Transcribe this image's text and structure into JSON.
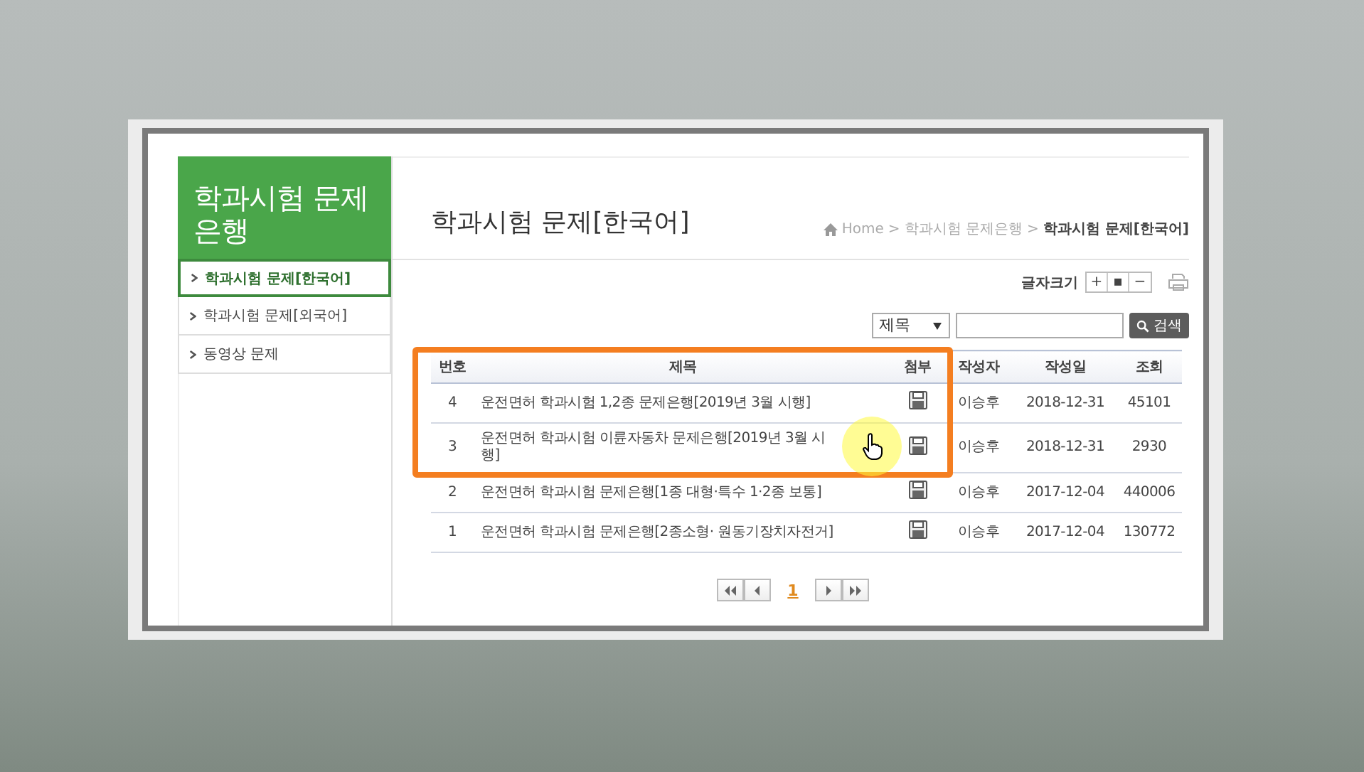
{
  "sidebar": {
    "title": "학과시험 문제은행",
    "items": [
      {
        "label": "학과시험 문제[한국어]",
        "selected": true
      },
      {
        "label": "학과시험 문제[외국어]",
        "selected": false
      },
      {
        "label": "동영상 문제",
        "selected": false
      }
    ]
  },
  "page": {
    "title": "학과시험 문제[한국어]",
    "breadcrumb": [
      "Home",
      "학과시험 문제은행",
      "학과시험 문제[한국어]"
    ],
    "separator": ">"
  },
  "font_size": {
    "label": "글자크기",
    "buttons": [
      "+",
      "▪",
      "−"
    ]
  },
  "search": {
    "option": "제목",
    "button": "검색"
  },
  "table": {
    "columns": [
      "번호",
      "제목",
      "첨부",
      "작성자",
      "작성일",
      "조회"
    ],
    "rows": [
      {
        "no": "4",
        "title": "운전면허 학과시험 1,2종 문제은행[2019년 3월 시행]",
        "attachment": true,
        "author": "이승후",
        "date": "2018-12-31",
        "views": "45101"
      },
      {
        "no": "3",
        "title": "운전면허 학과시험 이륜자동차 문제은행[2019년 3월 시행]",
        "attachment": true,
        "author": "이승후",
        "date": "2018-12-31",
        "views": "2930"
      },
      {
        "no": "2",
        "title": "운전면허 학과시험 문제은행[1종 대형·특수 1·2종 보통]",
        "attachment": true,
        "author": "이승후",
        "date": "2017-12-04",
        "views": "440006"
      },
      {
        "no": "1",
        "title": "운전면허 학과시험 문제은행[2종소형· 원동기장치자전거]",
        "attachment": true,
        "author": "이승후",
        "date": "2017-12-04",
        "views": "130772"
      }
    ]
  },
  "pagination": {
    "pages": [
      {
        "label": "1",
        "selected": true
      }
    ]
  }
}
